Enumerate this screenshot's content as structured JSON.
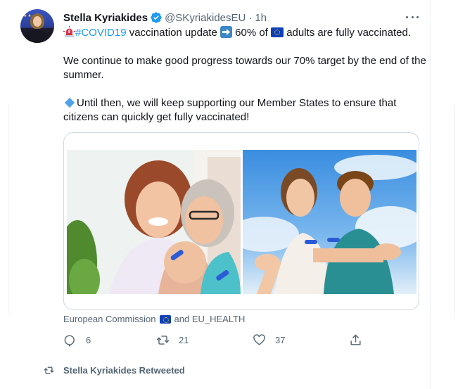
{
  "tweet": {
    "author_name": "Stella Kyriakides",
    "author_handle": "@SKyriakidesEU",
    "separator": "·",
    "time": "1h",
    "line1_hashtag": "#COVID19",
    "line1_a": " vaccination update ",
    "line1_b": " 60% of ",
    "line1_c": " adults are fully vaccinated.",
    "paragraph2": "We continue to make good progress towards our 70% target by the end of the summer.",
    "paragraph3": "Until then, we will keep supporting our Member States to ensure that citizens can quickly get fully vaccinated!",
    "tagged_a": "European Commission",
    "tagged_b": "and EU_HEALTH",
    "reply_count": "6",
    "retweet_count": "21",
    "like_count": "37"
  },
  "next": {
    "retweeted_label": "Stella Kyriakides Retweeted"
  },
  "icons": {
    "verified": "verified-badge-icon",
    "more": "more-dots-icon",
    "siren": "rotating-light-icon",
    "arrow": "right-arrow-icon",
    "eu_flag": "eu-flag-icon",
    "diamond": "small-blue-diamond-icon",
    "reply": "reply-icon",
    "retweet": "retweet-icon",
    "like": "heart-icon",
    "share": "share-icon"
  },
  "colors": {
    "link": "#1d9bf0",
    "secondary_text": "#536471",
    "verified": "#1d9bf0",
    "border": "#cfd9de"
  }
}
